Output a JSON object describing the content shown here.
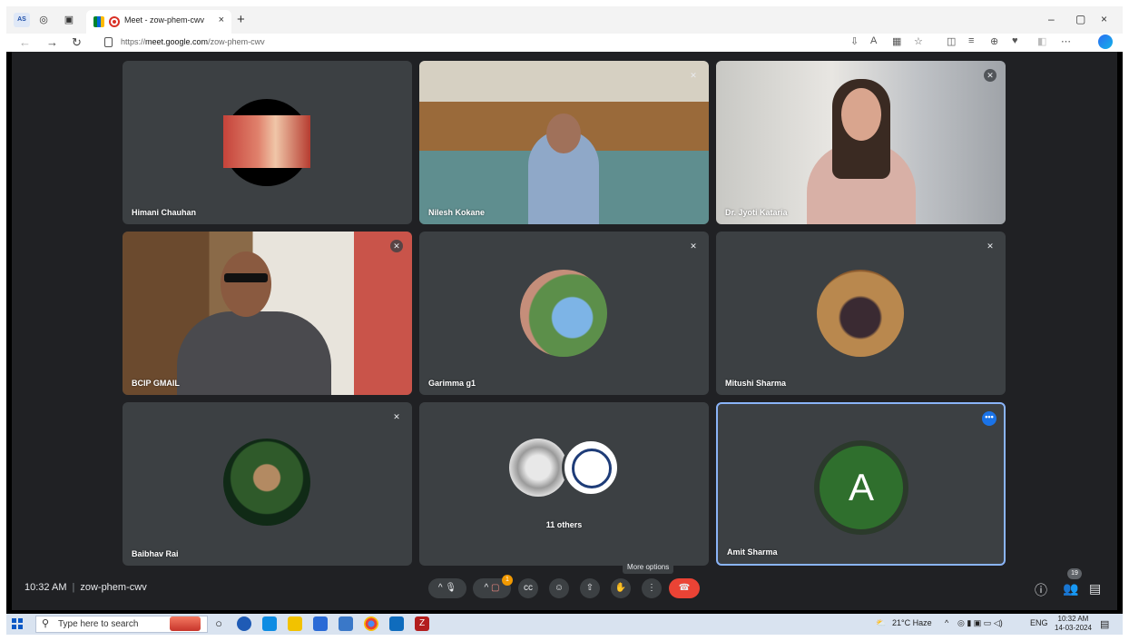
{
  "browser": {
    "profile_initials": "AS",
    "tab_title": "Meet - zow-phem-cwv",
    "tab_close": "×",
    "new_tab": "+",
    "url_prefix": "https://",
    "url_domain": "meet.google.com",
    "url_path": "/zow-phem-cwv",
    "window_controls": [
      "–",
      "▢",
      "×"
    ]
  },
  "participants": [
    {
      "name": "Himani Chauhan",
      "type": "avatar",
      "muted": false
    },
    {
      "name": "Nilesh Kokane",
      "type": "video",
      "muted": true
    },
    {
      "name": "Dr. Jyoti Kataria",
      "type": "video",
      "muted": true
    },
    {
      "name": "BCIP GMAIL",
      "type": "video",
      "muted": true
    },
    {
      "name": "Garimma g1",
      "type": "avatar",
      "muted": true
    },
    {
      "name": "Mitushi Sharma",
      "type": "avatar",
      "muted": true
    },
    {
      "name": "Baibhav Rai",
      "type": "avatar",
      "muted": true
    },
    {
      "name": "11 others",
      "type": "group",
      "muted": false
    },
    {
      "name": "Amit Sharma",
      "type": "letter",
      "letter": "A",
      "muted": false,
      "selected": true
    }
  ],
  "meeting": {
    "time": "10:32 AM",
    "code": "zow-phem-cwv",
    "tooltip": "More options",
    "participant_count": "19",
    "notification_count": "1"
  },
  "taskbar": {
    "search_placeholder": "Type here to search",
    "weather": "21°C  Haze",
    "lang": "ENG",
    "time": "10:32 AM",
    "date": "14-03-2024"
  },
  "colors": {
    "meet_bg": "#202124",
    "tile_bg": "#3c4043",
    "end_call": "#ea4335",
    "selected_border": "#8ab4f8",
    "letter_avatar": "#2f6f2d"
  }
}
